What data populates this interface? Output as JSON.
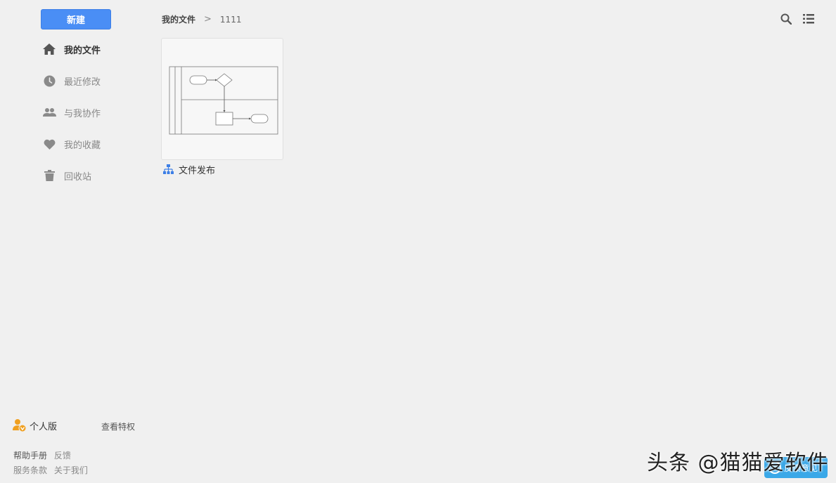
{
  "sidebar": {
    "new_button": "新建",
    "items": [
      {
        "label": "我的文件",
        "icon": "home-icon",
        "active": true
      },
      {
        "label": "最近修改",
        "icon": "clock-icon"
      },
      {
        "label": "与我协作",
        "icon": "users-icon"
      },
      {
        "label": "我的收藏",
        "icon": "heart-icon"
      },
      {
        "label": "回收站",
        "icon": "trash-icon"
      }
    ],
    "plan": {
      "label": "个人版",
      "link": "查看特权"
    },
    "footer": {
      "help": "帮助手册",
      "feedback": "反馈",
      "terms": "服务条款",
      "about": "关于我们"
    }
  },
  "breadcrumb": {
    "root": "我的文件",
    "separator": ">",
    "current": "1111"
  },
  "files": [
    {
      "name": "文件发布",
      "icon": "flowchart-icon"
    }
  ],
  "overlay": {
    "watermark": "头条 @猫猫爱软件",
    "feedback_button": "反馈意见"
  },
  "colors": {
    "accent": "#4a8ef5",
    "background": "#f0f0f0",
    "feedback": "#3aa8e8"
  }
}
